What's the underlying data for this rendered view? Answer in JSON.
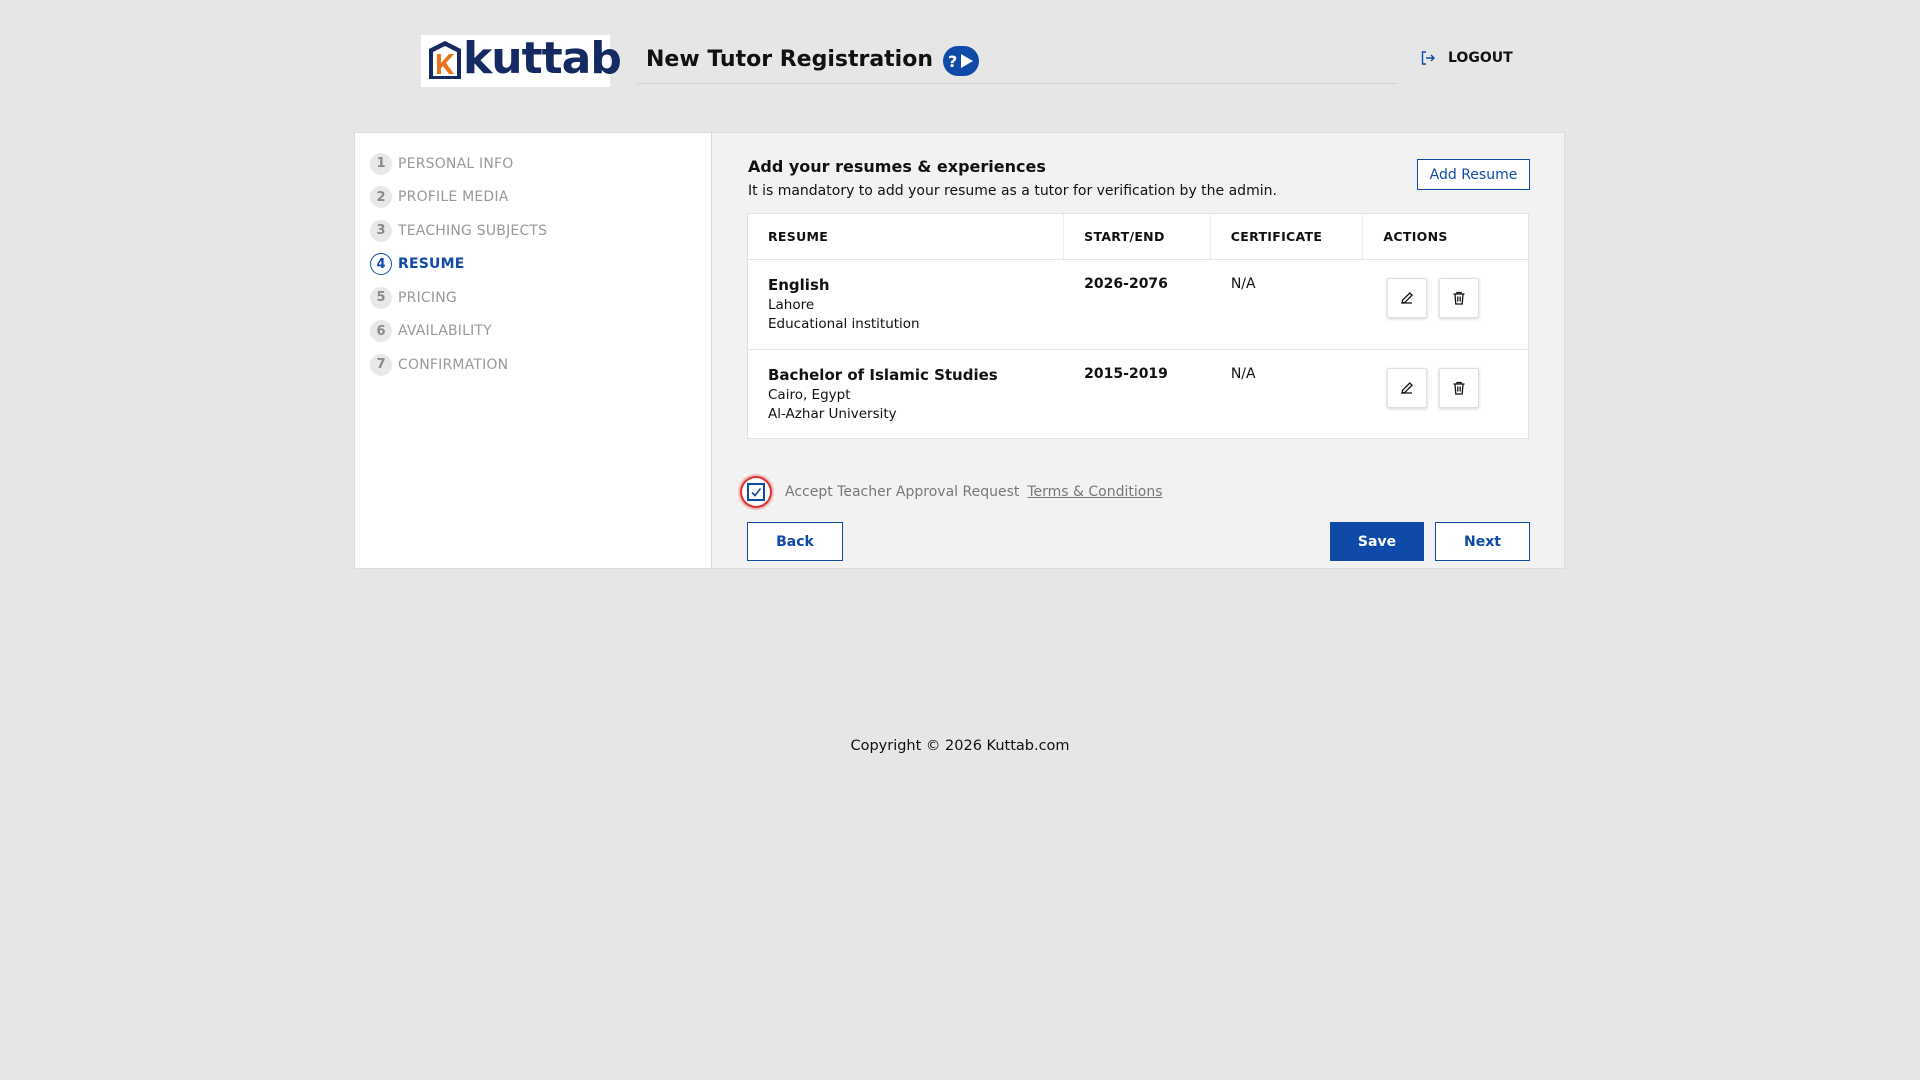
{
  "header": {
    "logo_text": "kuttab",
    "page_title": "New Tutor Registration",
    "logout_label": "LOGOUT"
  },
  "steps": [
    {
      "num": "1",
      "label": "PERSONAL INFO",
      "active": false
    },
    {
      "num": "2",
      "label": "PROFILE MEDIA",
      "active": false
    },
    {
      "num": "3",
      "label": "TEACHING SUBJECTS",
      "active": false
    },
    {
      "num": "4",
      "label": "RESUME",
      "active": true
    },
    {
      "num": "5",
      "label": "PRICING",
      "active": false
    },
    {
      "num": "6",
      "label": "AVAILABILITY",
      "active": false
    },
    {
      "num": "7",
      "label": "CONFIRMATION",
      "active": false
    }
  ],
  "main": {
    "title": "Add your resumes & experiences",
    "subtitle": "It is mandatory to add your resume as a tutor for verification by the admin.",
    "add_resume_label": "Add Resume"
  },
  "table": {
    "headers": [
      "RESUME",
      "START/END",
      "CERTIFICATE",
      "ACTIONS"
    ],
    "rows": [
      {
        "title": "English",
        "line1": "Lahore",
        "line2": "Educational institution",
        "period": "2026-2076",
        "certificate": "N/A"
      },
      {
        "title": "Bachelor of Islamic Studies",
        "line1": "Cairo, Egypt",
        "line2": "Al-Azhar University",
        "period": "2015-2019",
        "certificate": "N/A"
      }
    ]
  },
  "accept": {
    "label": "Accept Teacher Approval Request",
    "terms_label": "Terms & Conditions",
    "checked": true
  },
  "buttons": {
    "back": "Back",
    "save": "Save",
    "next": "Next"
  },
  "footer": {
    "copyright": "Copyright © 2026 Kuttab.com"
  },
  "colors": {
    "primary": "#0f4aa8",
    "background": "#e6e6e6",
    "logo_text": "#152a63",
    "logo_accent": "#e8731a"
  }
}
